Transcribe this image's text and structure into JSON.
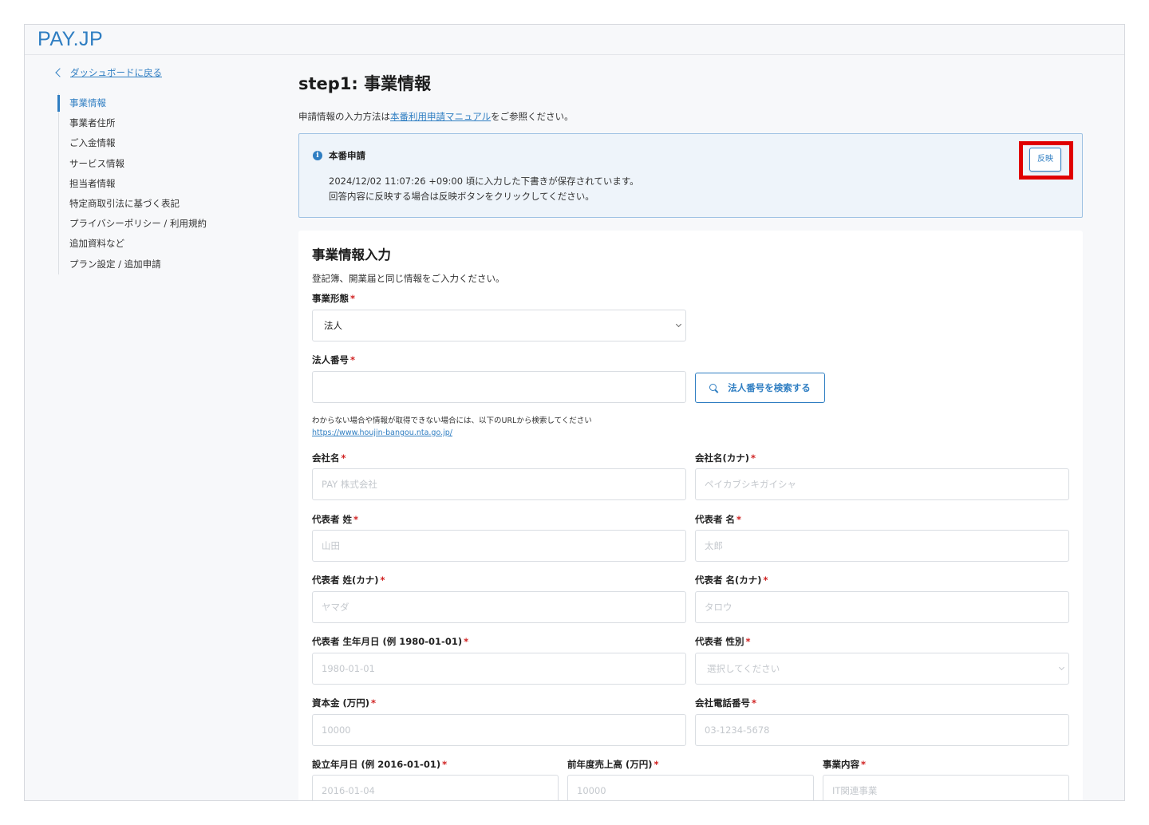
{
  "app": {
    "logo": "PAY.JP"
  },
  "back_link": {
    "label": "ダッシュボードに戻る"
  },
  "sidebar": {
    "items": [
      {
        "label": "事業情報"
      },
      {
        "label": "事業者住所"
      },
      {
        "label": "ご入金情報"
      },
      {
        "label": "サービス情報"
      },
      {
        "label": "担当者情報"
      },
      {
        "label": "特定商取引法に基づく表記"
      },
      {
        "label": "プライバシーポリシー / 利用規約"
      },
      {
        "label": "追加資料など"
      },
      {
        "label": "プラン設定 / 追加申請"
      }
    ],
    "active_index": 0
  },
  "page": {
    "title": "step1: 事業情報",
    "intro_prefix": "申請情報の入力方法は",
    "intro_link": "本番利用申請マニュアル",
    "intro_suffix": "をご参照ください。"
  },
  "notice": {
    "icon": "info-icon",
    "title": "本番申請",
    "line1": "2024/12/02 11:07:26 +09:00 頃に入力した下書きが保存されています。",
    "line2": "回答内容に反映する場合は反映ボタンをクリックしてください。",
    "button_label": "反映",
    "highlight_color": "#e00000"
  },
  "form": {
    "section_title": "事業情報入力",
    "section_desc": "登記簿、開業届と同じ情報をご入力ください。",
    "required_mark": "*",
    "business_type": {
      "label": "事業形態",
      "value": "法人"
    },
    "corp_number": {
      "label": "法人番号",
      "value": "",
      "search_button": "法人番号を検索する",
      "hint": "わからない場合や情報が取得できない場合には、以下のURLから検索してください",
      "hint_link": "https://www.houjin-bangou.nta.go.jp/"
    },
    "company_name": {
      "label": "会社名",
      "placeholder": "PAY 株式会社"
    },
    "company_name_kana": {
      "label": "会社名(カナ)",
      "placeholder": "ペイカブシキガイシャ"
    },
    "rep_last_name": {
      "label": "代表者 姓",
      "placeholder": "山田"
    },
    "rep_first_name": {
      "label": "代表者 名",
      "placeholder": "太郎"
    },
    "rep_last_name_kana": {
      "label": "代表者 姓(カナ)",
      "placeholder": "ヤマダ"
    },
    "rep_first_name_kana": {
      "label": "代表者 名(カナ)",
      "placeholder": "タロウ"
    },
    "rep_birthdate": {
      "label": "代表者 生年月日 (例 1980-01-01)",
      "placeholder": "1980-01-01"
    },
    "rep_gender": {
      "label": "代表者 性別",
      "placeholder": "選択してください"
    },
    "capital": {
      "label": "資本金 (万円)",
      "placeholder": "10000"
    },
    "company_phone": {
      "label": "会社電話番号",
      "placeholder": "03-1234-5678"
    },
    "founded_date": {
      "label": "設立年月日 (例 2016-01-01)",
      "placeholder": "2016-01-04"
    },
    "prev_year_sales": {
      "label": "前年度売上高 (万円)",
      "placeholder": "10000"
    },
    "business_content": {
      "label": "事業内容",
      "placeholder": "IT関連事業"
    }
  },
  "colors": {
    "accent": "#2f7ec2",
    "required": "#d02020",
    "notice_bg": "#eef4fa",
    "notice_border": "#9fc2e3"
  }
}
